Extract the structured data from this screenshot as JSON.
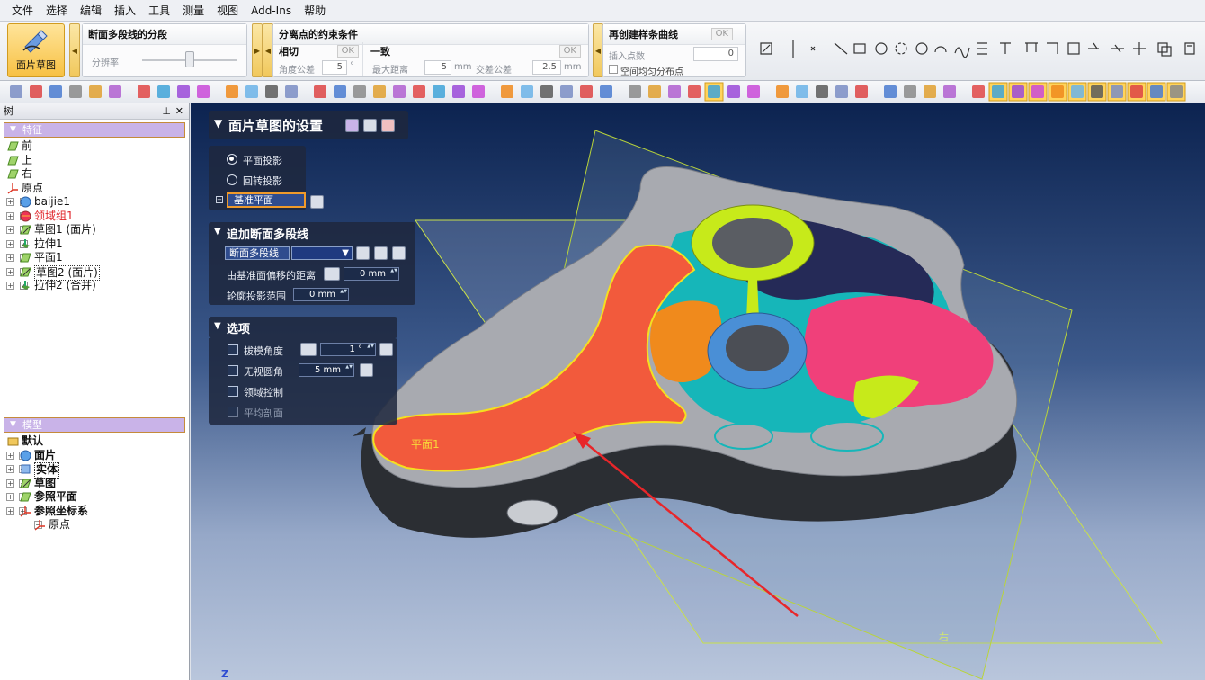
{
  "menu": [
    "文件",
    "选择",
    "编辑",
    "插入",
    "工具",
    "测量",
    "视图",
    "Add-Ins",
    "帮助"
  ],
  "ribbon": {
    "main_button": "面片草图",
    "segment": {
      "title": "断面多段线的分段",
      "resolution_label": "分辨率"
    },
    "constraint": {
      "title": "分离点的约束条件",
      "tangent": "相切",
      "angle_tol_label": "角度公差",
      "angle_tol_value": "5",
      "angle_unit": "°",
      "coincident": "一致",
      "max_dist_label": "最大距离",
      "max_dist_value": "5",
      "max_dist_unit": "mm",
      "cross_tol_label": "交差公差",
      "cross_tol_value": "2.5",
      "cross_tol_unit": "mm",
      "ok": "OK"
    },
    "recreate": {
      "title": "再创建样条曲线",
      "insert_label": "插入点数",
      "insert_value": "0",
      "uniform_label": "空间均匀分布点",
      "ok": "OK"
    }
  },
  "tree_panel": {
    "title": "树",
    "feature_section": "特征",
    "features": [
      {
        "label": "前"
      },
      {
        "label": "上"
      },
      {
        "label": "右"
      },
      {
        "label": "原点"
      },
      {
        "label": "baijie1"
      },
      {
        "label": "领域组1"
      },
      {
        "label": "草图1 (面片)"
      },
      {
        "label": "拉伸1"
      },
      {
        "label": "平面1"
      },
      {
        "label": "草图2 (面片)"
      },
      {
        "label": "拉伸2 (合并)"
      }
    ],
    "model_section": "模型",
    "model_items": [
      {
        "label": "默认"
      },
      {
        "label": "面片"
      },
      {
        "label": "实体"
      },
      {
        "label": "草图"
      },
      {
        "label": "参照平面"
      },
      {
        "label": "参照坐标系"
      },
      {
        "label": "原点"
      }
    ]
  },
  "dialog": {
    "title": "面片草图的设置",
    "radio_plane": "平面投影",
    "radio_rotate": "回转投影",
    "base_plane": "基准平面",
    "section2_title": "追加断面多段线",
    "polyline_label": "断面多段线",
    "offset_label": "由基准面偏移的距离",
    "offset_value": "0 mm",
    "contour_label": "轮廓投影范围",
    "contour_value": "0 mm",
    "section3_title": "选项",
    "draft_label": "拔模角度",
    "draft_value": "1 °",
    "fillet_label": "无视圆角",
    "fillet_value": "5 mm",
    "region_label": "领域控制",
    "average_label": "平均剖面"
  },
  "viewport": {
    "plane_label": "平面1",
    "right_label": "右",
    "axis_label": "Z"
  },
  "colors": {
    "accent_orange": "#f7c143",
    "highlight_region": "#f25a3c",
    "yellow_green": "#c7ea1a",
    "blue_ring": "#4a8fd6",
    "pink_region": "#f0407a",
    "teal": "#16b6b9",
    "arrow_red": "#e8262a"
  }
}
